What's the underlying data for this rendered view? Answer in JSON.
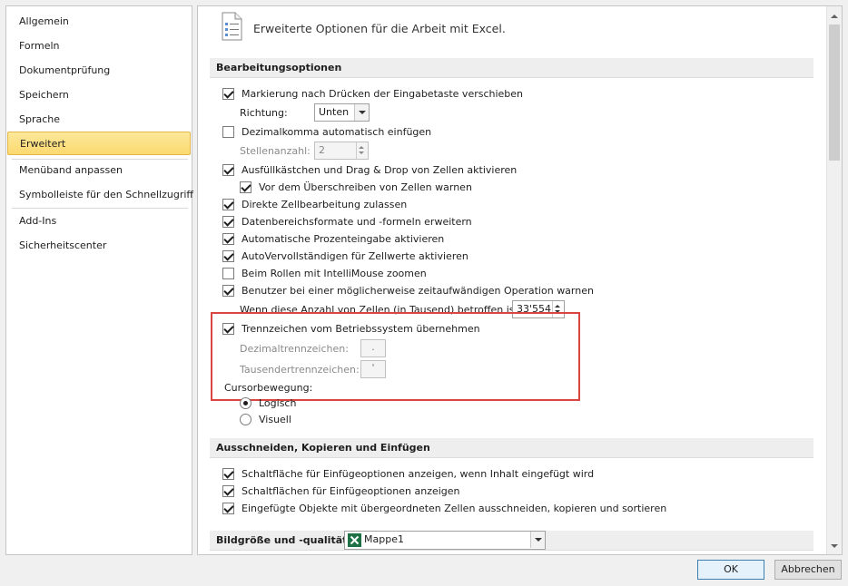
{
  "sidebar": {
    "items": [
      {
        "label": "Allgemein"
      },
      {
        "label": "Formeln"
      },
      {
        "label": "Dokumentprüfung"
      },
      {
        "label": "Speichern"
      },
      {
        "label": "Sprache"
      },
      {
        "label": "Erweitert",
        "active": true
      },
      {
        "label": "Menüband anpassen"
      },
      {
        "label": "Symbolleiste für den Schnellzugriff"
      },
      {
        "label": "Add-Ins"
      },
      {
        "label": "Sicherheitscenter"
      }
    ]
  },
  "header": {
    "title": "Erweiterte Optionen für die Arbeit mit Excel.",
    "icon": "options-page-icon"
  },
  "sections": {
    "edit": "Bearbeitungsoptionen",
    "cut": "Ausschneiden, Kopieren und Einfügen",
    "image": "Bildgröße und -qualität"
  },
  "edit_options": {
    "move_after_enter": {
      "label": "Markierung nach Drücken der Eingabetaste verschieben",
      "checked": true
    },
    "direction_label": "Richtung:",
    "direction_value": "Unten",
    "auto_decimal": {
      "label": "Dezimalkomma automatisch einfügen",
      "checked": false
    },
    "places_label": "Stellenanzahl:",
    "places_value": "2",
    "fill_handle": {
      "label": "Ausfüllkästchen und Drag & Drop von Zellen aktivieren",
      "checked": true
    },
    "overwrite_warn": {
      "label": "Vor dem Überschreiben von Zellen warnen",
      "checked": true
    },
    "direct_edit": {
      "label": "Direkte Zellbearbeitung zulassen",
      "checked": true
    },
    "extend_formats": {
      "label": "Datenbereichsformate und -formeln erweitern",
      "checked": true
    },
    "auto_percent": {
      "label": "Automatische Prozenteingabe aktivieren",
      "checked": true
    },
    "autocomplete": {
      "label": "AutoVervollständigen für Zellwerte aktivieren",
      "checked": true
    },
    "intellimouse": {
      "label": "Beim Rollen mit IntelliMouse zoomen",
      "checked": false
    },
    "alert_slow": {
      "label": "Benutzer bei einer möglicherweise zeitaufwändigen Operation warnen",
      "checked": true
    },
    "cells_label": "Wenn diese Anzahl von Zellen (in Tausend) betroffen ist:",
    "cells_value": "33'554",
    "system_separators": {
      "label": "Trennzeichen vom Betriebssystem übernehmen",
      "checked": true
    },
    "decimal_sep_label": "Dezimaltrennzeichen:",
    "decimal_sep_value": ".",
    "thousand_sep_label": "Tausendertrennzeichen:",
    "thousand_sep_value": "'",
    "cursor_label": "Cursorbewegung:",
    "cursor_logical": {
      "label": "Logisch",
      "checked": true
    },
    "cursor_visual": {
      "label": "Visuell",
      "checked": false
    }
  },
  "cut_options": {
    "paste_options_btn": {
      "label": "Schaltfläche für Einfügeoptionen anzeigen, wenn Inhalt eingefügt wird",
      "checked": true
    },
    "insert_options_btn": {
      "label": "Schaltflächen für Einfügeoptionen anzeigen",
      "checked": true
    },
    "cut_objects": {
      "label": "Eingefügte Objekte mit übergeordneten Zellen ausschneiden, kopieren und sortieren",
      "checked": true
    }
  },
  "image_workbook": "Mappe1",
  "buttons": {
    "ok": "OK",
    "cancel": "Abbrechen"
  },
  "colors": {
    "accent_active": "#fbd970",
    "highlight_border": "#d9463f",
    "excel_green": "#1e7145"
  }
}
